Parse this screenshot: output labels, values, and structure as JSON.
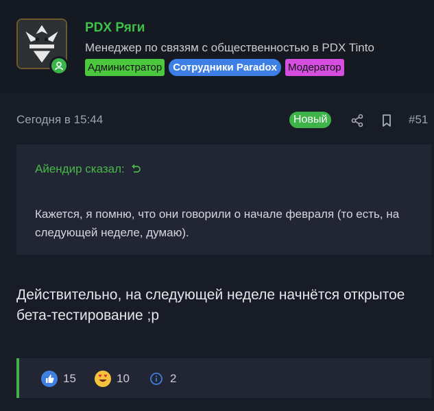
{
  "user": {
    "name": "PDX Ряги",
    "title": "Менеджер по связям с общественностью в PDX Tinto",
    "badges": {
      "admin": "Администратор",
      "staff": "Сотрудники Paradox",
      "mod": "Модератор"
    }
  },
  "post": {
    "timestamp": "Сегодня в 15:44",
    "new_label": "Новый",
    "number": "#51",
    "body": "Действительно, на следующей неделе начнётся открытое бета-тестирование ;р"
  },
  "quote": {
    "author": "Айендир сказал:",
    "text": "Кажется, я помню, что они говорили о начале февраля (то есть, на следующей неделе, думаю)."
  },
  "reactions": {
    "like_count": "15",
    "love_count": "10",
    "info_count": "2"
  },
  "colors": {
    "background": "#181c26",
    "accent_green": "#3eb34a",
    "admin_badge": "#4cc83f",
    "staff_badge": "#3e7fe6",
    "mod_badge": "#d64ee0"
  },
  "icons": {
    "avatar": "pdx-emblem-avatar",
    "online": "online-status-icon",
    "share": "share-icon",
    "bookmark": "bookmark-icon",
    "quote_jump": "quote-jump-icon",
    "like": "like-icon",
    "love": "love-eyes-icon",
    "info": "info-icon"
  }
}
